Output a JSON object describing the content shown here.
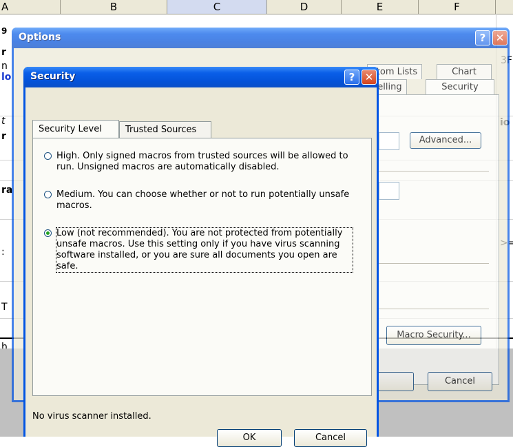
{
  "spreadsheet": {
    "columns": [
      "A",
      "B",
      "C",
      "D",
      "E",
      "F"
    ],
    "selected_column": "C",
    "fragments": [
      "9",
      "r",
      "n",
      "lo",
      "t",
      "r",
      "ra",
      ":",
      "T",
      "h",
      "3F",
      "io",
      ">="
    ]
  },
  "options_dialog": {
    "title": "Options",
    "tabs_row1": [
      "stom Lists",
      "Chart"
    ],
    "tabs_row2": [
      "pelling",
      "Security"
    ],
    "advanced_button": "Advanced...",
    "macro_security_button": "Macro Security...",
    "cancel_button": "Cancel"
  },
  "security_dialog": {
    "title": "Security",
    "tabs": [
      "Security Level",
      "Trusted Sources"
    ],
    "active_tab": "Security Level",
    "options": [
      {
        "label": "High. Only signed macros from trusted sources will be allowed to run. Unsigned macros are automatically disabled.",
        "checked": false
      },
      {
        "label": "Medium. You can choose whether or not to run potentially unsafe macros.",
        "checked": false
      },
      {
        "label": "Low (not recommended). You are not protected from potentially unsafe macros. Use this setting only if you have virus scanning software installed, or you are sure all documents you open are safe.",
        "checked": true
      }
    ],
    "status": "No virus scanner installed.",
    "ok_button": "OK",
    "cancel_button": "Cancel"
  },
  "icons": {
    "help": "?",
    "close": "✕"
  }
}
